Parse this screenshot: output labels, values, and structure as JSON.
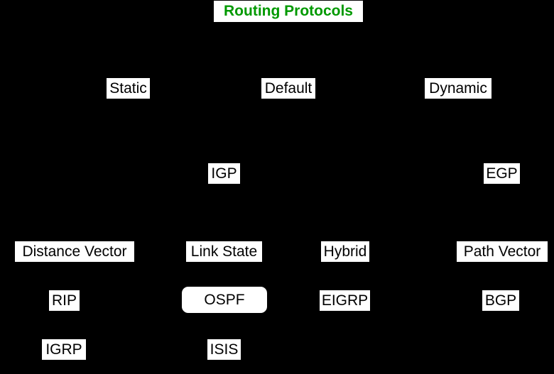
{
  "diagram": {
    "title": "Routing Protocols",
    "background_color": "#000000",
    "node_fill_color": "#ffffff",
    "node_text_color": "#000000",
    "title_text_color": "#009900",
    "nodes": [
      {
        "id": "title",
        "label": "Routing Protocols",
        "level": 0,
        "style": "title"
      },
      {
        "id": "static",
        "label": "Static",
        "level": 1,
        "style": "plain"
      },
      {
        "id": "default",
        "label": "Default",
        "level": 1,
        "style": "plain"
      },
      {
        "id": "dynamic",
        "label": "Dynamic",
        "level": 1,
        "style": "plain"
      },
      {
        "id": "igp",
        "label": "IGP",
        "level": 2,
        "style": "plain"
      },
      {
        "id": "egp",
        "label": "EGP",
        "level": 2,
        "style": "plain"
      },
      {
        "id": "distance-vector",
        "label": "Distance Vector",
        "level": 3,
        "style": "plain"
      },
      {
        "id": "link-state",
        "label": "Link State",
        "level": 3,
        "style": "plain"
      },
      {
        "id": "hybrid",
        "label": "Hybrid",
        "level": 3,
        "style": "plain"
      },
      {
        "id": "path-vector",
        "label": "Path Vector",
        "level": 3,
        "style": "plain"
      },
      {
        "id": "rip",
        "label": "RIP",
        "level": 4,
        "style": "plain"
      },
      {
        "id": "ospf",
        "label": "OSPF",
        "level": 4,
        "style": "highlight"
      },
      {
        "id": "eigrp",
        "label": "EIGRP",
        "level": 4,
        "style": "plain"
      },
      {
        "id": "bgp",
        "label": "BGP",
        "level": 4,
        "style": "plain"
      },
      {
        "id": "igrp",
        "label": "IGRP",
        "level": 5,
        "style": "plain"
      },
      {
        "id": "isis",
        "label": "ISIS",
        "level": 5,
        "style": "plain"
      }
    ]
  }
}
